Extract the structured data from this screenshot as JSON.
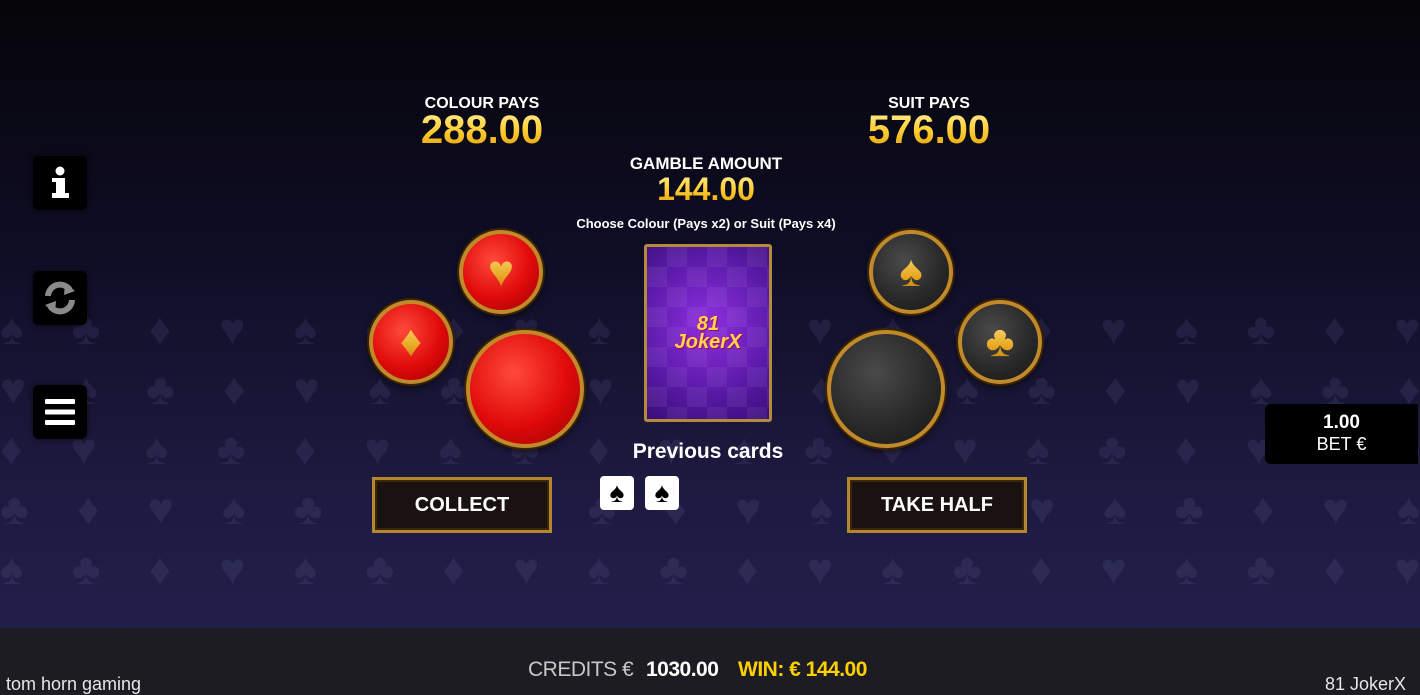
{
  "pays": {
    "colour_label": "COLOUR PAYS",
    "colour_value": "288.00",
    "suit_label": "SUIT PAYS",
    "suit_value": "576.00"
  },
  "gamble": {
    "label": "GAMBLE AMOUNT",
    "value": "144.00",
    "instruction": "Choose Colour (Pays x2) or Suit (Pays x4)"
  },
  "card_back": {
    "logo_top": "81",
    "logo_bottom": "JokerX"
  },
  "suits": {
    "heart": "♥",
    "diamond": "♦",
    "spade": "♠",
    "club": "♣"
  },
  "previous": {
    "label": "Previous cards",
    "cards": [
      "♠",
      "♠"
    ]
  },
  "buttons": {
    "collect": "COLLECT",
    "take_half": "TAKE HALF"
  },
  "bet": {
    "value": "1.00",
    "label": "BET €"
  },
  "footer": {
    "brand": "tom horn gaming",
    "credits_label": "CREDITS €",
    "credits_value": "1030.00",
    "win_label": "WIN: € 144.00",
    "game_name": "81 JokerX"
  },
  "icons": {
    "info": "info-icon",
    "refresh": "refresh-icon",
    "menu": "menu-icon"
  },
  "colors": {
    "gold": "#ffcf3a",
    "red": "#e00a0a",
    "win_yellow": "#ffd000"
  }
}
